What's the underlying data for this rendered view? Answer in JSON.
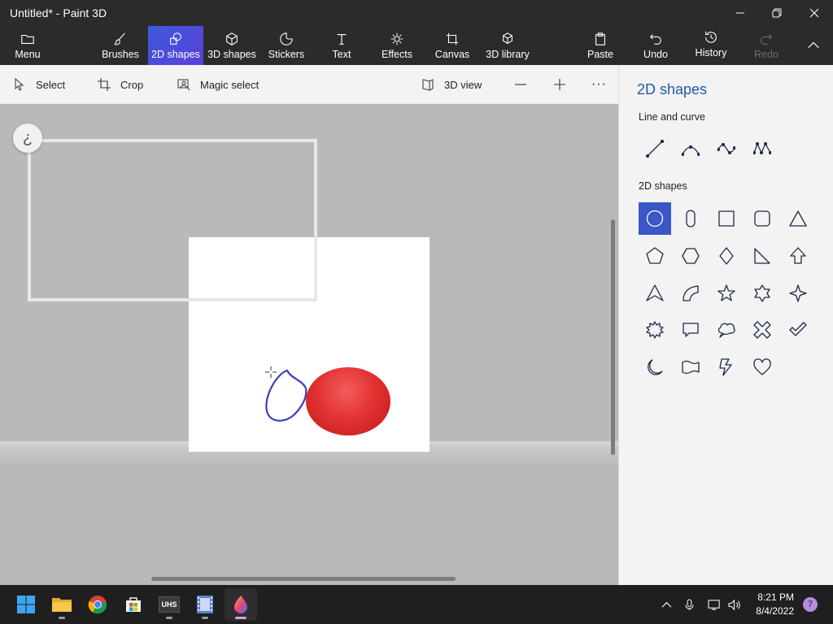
{
  "window": {
    "title": "Untitled* - Paint 3D"
  },
  "ribbon": {
    "menu": "Menu",
    "brushes": "Brushes",
    "shapes_2d": "2D shapes",
    "shapes_3d": "3D shapes",
    "stickers": "Stickers",
    "text": "Text",
    "effects": "Effects",
    "canvas": "Canvas",
    "library_3d": "3D library",
    "paste": "Paste",
    "undo": "Undo",
    "history": "History",
    "redo": "Redo",
    "active_tab": "2D shapes"
  },
  "toolbar": {
    "select": "Select",
    "crop": "Crop",
    "magic_select": "Magic select",
    "view_3d": "3D view",
    "more": "···"
  },
  "workspace": {
    "help_glyph": "¿"
  },
  "panel": {
    "title": "2D shapes",
    "section_lines": "Line and curve",
    "section_shapes": "2D shapes",
    "selected_shape": "circle",
    "line_tools": [
      "line-icon",
      "curve-icon",
      "two-point-curve-icon",
      "three-point-curve-icon"
    ],
    "shapes": [
      "circle-icon",
      "capsule-icon",
      "square-icon",
      "rounded-square-icon",
      "triangle-icon",
      "pentagon-icon",
      "hexagon-icon",
      "diamond-icon",
      "right-triangle-icon",
      "arrow-up-icon",
      "arrowhead-icon",
      "quarter-circle-icon",
      "star-5-icon",
      "star-6-icon",
      "star-4-icon",
      "burst-icon",
      "speech-bubble-icon",
      "thought-bubble-icon",
      "x-mark-icon",
      "check-mark-icon",
      "crescent-moon-icon",
      "banner-icon",
      "lightning-icon",
      "heart-icon"
    ]
  },
  "taskbar": {
    "apps": [
      "start-icon",
      "file-explorer-icon",
      "chrome-icon",
      "store-icon",
      "uhs-app-icon",
      "film-app-icon",
      "paint-3d-icon"
    ],
    "uhs_label": "UHS",
    "time": "8:21 PM",
    "date": "8/4/2022",
    "notification_count": "7"
  },
  "colors": {
    "accent": "#3a56c7",
    "titlebar_bg": "#2b2b2b",
    "panel_title": "#2159a8",
    "shape_fill": "#e33333",
    "stroke": "#3b3fb3"
  }
}
